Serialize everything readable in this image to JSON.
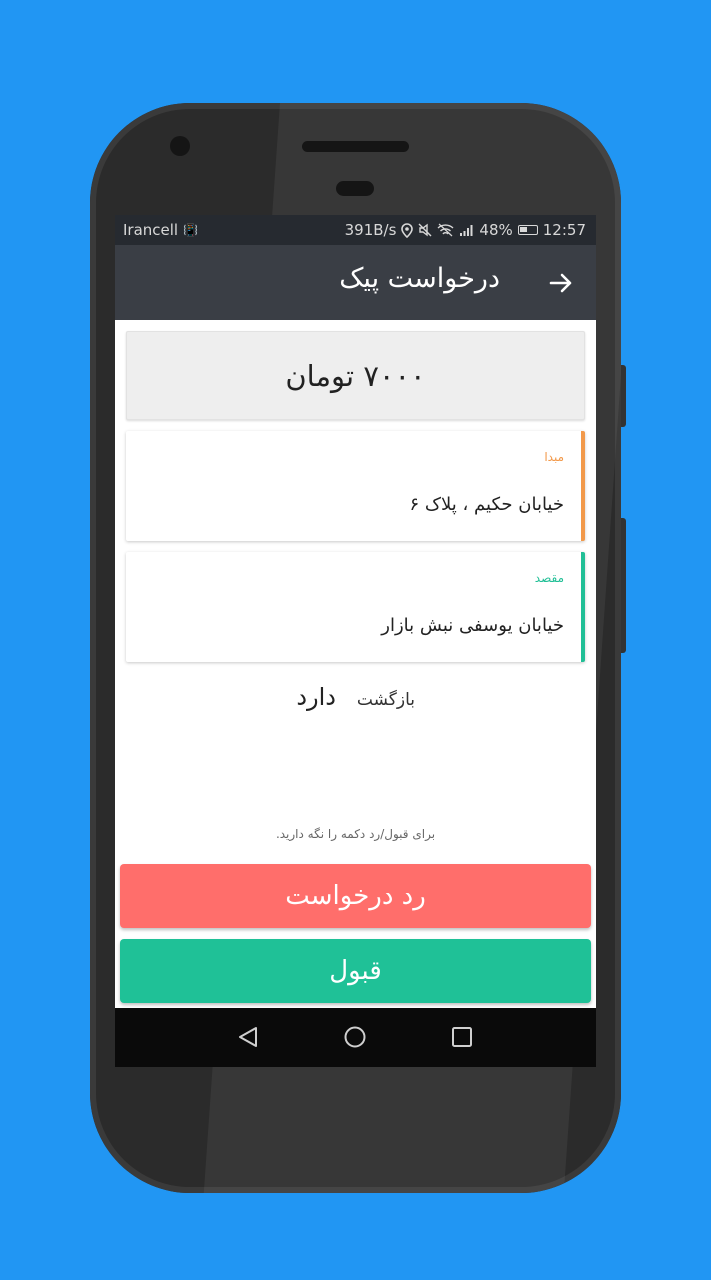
{
  "status_bar": {
    "carrier": "Irancell",
    "speed": "391B/s",
    "battery": "48%",
    "time": "12:57"
  },
  "app_bar": {
    "title": "درخواست پیک",
    "back_icon": "arrow-right-icon"
  },
  "price": "۷۰۰۰ تومان",
  "origin": {
    "tag": "مبدا",
    "address": "خیابان حکیم ، پلاک ۶",
    "accent": "#f2994a"
  },
  "destination": {
    "tag": "مقصد",
    "address": "خیابان یوسفی نبش بازار",
    "accent": "#21bf96"
  },
  "return_trip": {
    "label": "بازگشت",
    "value": "دارد"
  },
  "hint": "برای قبول/رد دکمه را نگه دارید.",
  "buttons": {
    "reject": "رد درخواست",
    "accept": "قبول",
    "reject_color": "#ff6e6b",
    "accept_color": "#1fc197"
  },
  "nav": {
    "back": "triangle-back-icon",
    "home": "circle-home-icon",
    "recents": "square-recents-icon"
  },
  "colors": {
    "background": "#2196F3",
    "app_bar": "#3a3e45"
  }
}
